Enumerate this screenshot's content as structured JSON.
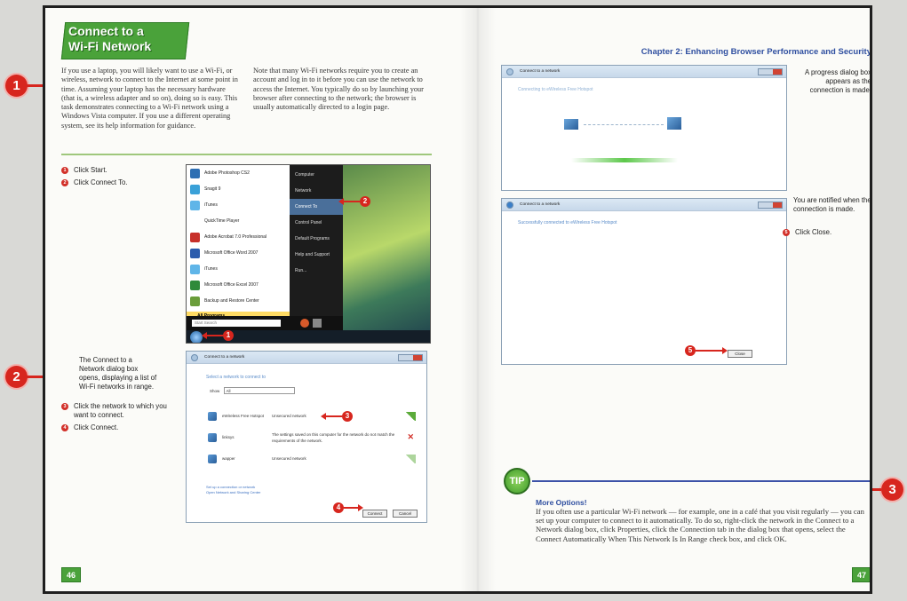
{
  "left_page": {
    "title_line1": "Connect to a",
    "title_line2": "Wi-Fi Network",
    "intro_col1": "If you use a laptop, you will likely want to use a Wi-Fi, or wireless, network to connect to the Internet at some point in time. Assuming your laptop has the necessary hardware (that is, a wireless adapter and so on), doing so is easy. This task demonstrates connecting to a Wi-Fi network using a Windows Vista computer. If you use a different operating system, see its help information for guidance.",
    "intro_col2": "Note that many Wi-Fi networks require you to create an account and log in to it before you can use the network to access the Internet. You typically do so by launching your browser after connecting to the network; the browser is usually automatically directed to a login page.",
    "steps_a": [
      {
        "num": "1",
        "text": "Click Start."
      },
      {
        "num": "2",
        "text": "Click Connect To."
      }
    ],
    "caption_b": "The Connect to a Network dialog box opens, displaying a list of Wi-Fi networks in range.",
    "steps_b": [
      {
        "num": "3",
        "text": "Click the network to which you want to connect."
      },
      {
        "num": "4",
        "text": "Click Connect."
      }
    ],
    "page_number": "46"
  },
  "start_menu": {
    "left_items": [
      "Adobe Photoshop CS2",
      "Snagit 9",
      "iTunes",
      "QuickTime Player",
      "Adobe Acrobat 7.0 Professional",
      "Microsoft Office Word 2007",
      "iTunes",
      "Microsoft Office Excel 2007",
      "Backup and Restore Center"
    ],
    "all_programs": "All Programs",
    "search_placeholder": "Start Search",
    "right_items": [
      "Computer",
      "Network",
      "Connect To",
      "Control Panel",
      "Default Programs",
      "Help and Support",
      "Run..."
    ],
    "callout_1": "1",
    "callout_2": "2"
  },
  "connect_dialog": {
    "title": "Connect to a network",
    "heading": "Select a network to connect to",
    "show_label": "Show",
    "show_value": "All",
    "networks": [
      {
        "name": "eWireless Free Hotspot",
        "status": "Unsecured network"
      },
      {
        "name": "linksys",
        "status": "The settings saved on this computer for the network do not match the requirements of the network."
      },
      {
        "name": "wapper",
        "status": "Unsecured network"
      }
    ],
    "link1": "Set up a connection or network",
    "link2": "Open Network and Sharing Center",
    "connect_label": "Connect",
    "cancel_label": "Cancel",
    "callout_3": "3",
    "callout_4": "4"
  },
  "right_page": {
    "header": "Chapter 2: Enhancing Browser Performance and Security",
    "caption_progress": "A progress dialog box appears as the connection is made.",
    "caption_notified": "You are notified when the connection is made.",
    "step5": {
      "num": "5",
      "text": "Click Close."
    },
    "page_number": "47"
  },
  "progress_dialog": {
    "title": "Connect to a network",
    "message": "Connecting to eWireless Free Hotspot"
  },
  "success_dialog": {
    "title": "Connect to a network",
    "message": "Successfully connected to eWireless Free Hotspot",
    "close_label": "Close",
    "callout_5": "5"
  },
  "tip": {
    "badge": "TIP",
    "heading": "More Options!",
    "body": "If you often use a particular Wi-Fi network — for example, one in a café that you visit regularly — you can set up your computer to connect to it automatically. To do so, right-click the network in the Connect to a Network dialog box, click Properties, click the Connection tab in the dialog box that opens, select the Connect Automatically When This Network Is In Range check box, and click OK."
  },
  "big_callouts": [
    "1",
    "2",
    "3"
  ],
  "colors": {
    "accent_green": "#4aa23a",
    "callout_red": "#d7261e",
    "header_blue": "#2f4fa0"
  }
}
